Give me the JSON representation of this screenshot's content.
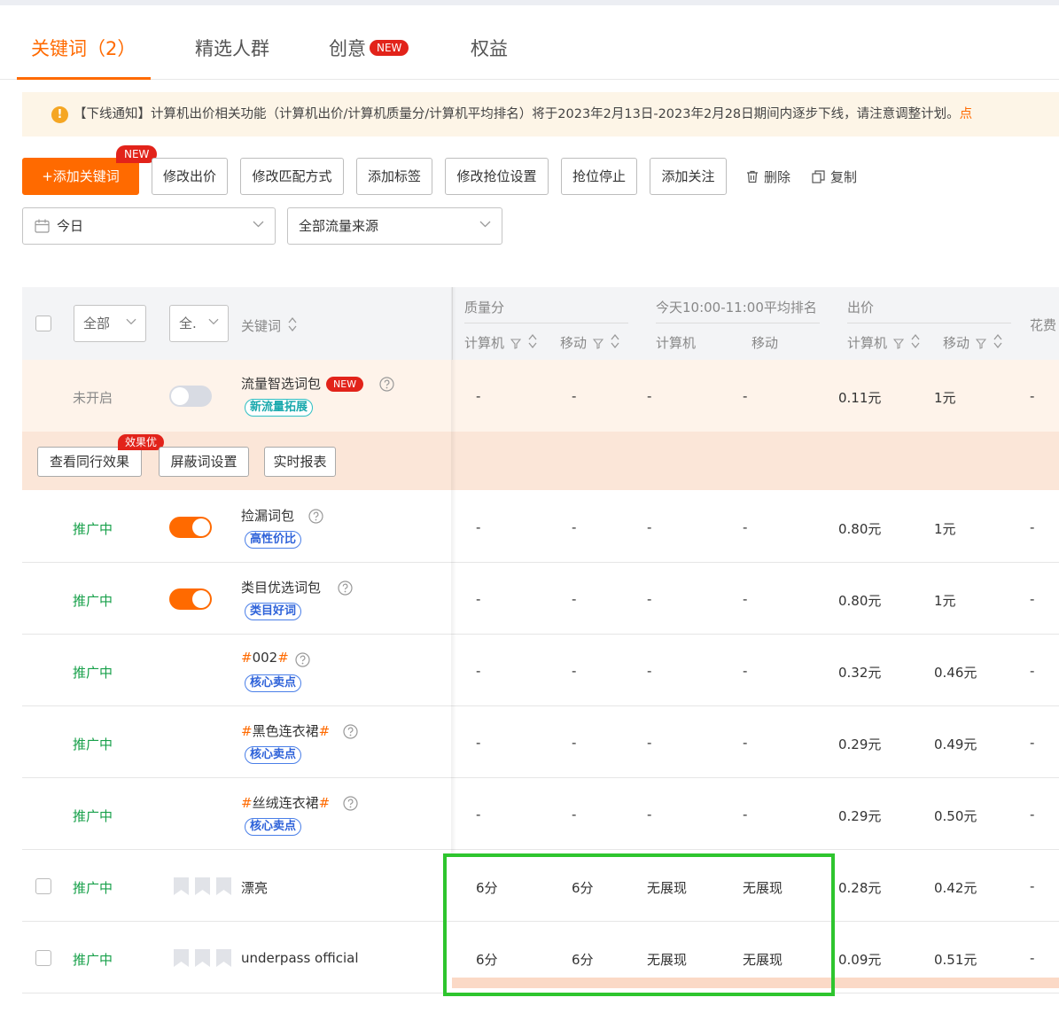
{
  "tabs": [
    {
      "label": "关键词（2）",
      "active": true
    },
    {
      "label": "精选人群"
    },
    {
      "label": "创意",
      "badge": "NEW"
    },
    {
      "label": "权益"
    }
  ],
  "notice": {
    "text": "【下线通知】计算机出价相关功能（计算机出价/计算机质量分/计算机平均排名）将于2023年2月13日-2023年2月28日期间内逐步下线，请注意调整计划。",
    "link": "点"
  },
  "toolbar": {
    "add_keyword": "+添加关键词",
    "add_keyword_badge": "NEW",
    "modify_bid": "修改出价",
    "modify_match": "修改匹配方式",
    "add_tag": "添加标签",
    "modify_rank": "修改抢位设置",
    "stop_rank": "抢位停止",
    "add_follow": "添加关注",
    "delete": "删除",
    "copy": "复制"
  },
  "filters": {
    "date": "今日",
    "traffic_source": "全部流量来源"
  },
  "table_header": {
    "status_select": "全部",
    "type_select": "全.",
    "keyword": "关键词",
    "quality_group": "质量分",
    "quality_pc": "计算机",
    "quality_mobile": "移动",
    "rank_group": "今天10:00-11:00平均排名",
    "rank_pc": "计算机",
    "rank_mobile": "移动",
    "bid_group": "出价",
    "bid_pc": "计算机",
    "bid_mobile": "移动",
    "cost": "花费"
  },
  "package_row": {
    "status": "未开启",
    "name": "流量智选词包",
    "badge": "NEW",
    "tag": "新流量拓展",
    "q_pc": "-",
    "q_m": "-",
    "r_pc": "-",
    "r_m": "-",
    "bid_pc": "0.11元",
    "bid_m": "1元",
    "cost": "-"
  },
  "sub_actions": {
    "peer_effect": "查看同行效果",
    "peer_badge": "效果优",
    "block_words": "屏蔽词设置",
    "realtime": "实时报表"
  },
  "rows": [
    {
      "status": "推广中",
      "name": "捡漏词包",
      "tag": "高性价比",
      "q_pc": "-",
      "q_m": "-",
      "r_pc": "-",
      "r_m": "-",
      "bid_pc": "0.80元",
      "bid_m": "1元",
      "cost": "-"
    },
    {
      "status": "推广中",
      "name": "类目优选词包",
      "tag": "类目好词",
      "q_pc": "-",
      "q_m": "-",
      "r_pc": "-",
      "r_m": "-",
      "bid_pc": "0.80元",
      "bid_m": "1元",
      "cost": "-"
    },
    {
      "status": "推广中",
      "hash": "#",
      "name": "002",
      "tag": "核心卖点",
      "q_pc": "-",
      "q_m": "-",
      "r_pc": "-",
      "r_m": "-",
      "bid_pc": "0.32元",
      "bid_m": "0.46元",
      "cost": "-"
    },
    {
      "status": "推广中",
      "hash": "#",
      "name": "黑色连衣裙",
      "tag": "核心卖点",
      "q_pc": "-",
      "q_m": "-",
      "r_pc": "-",
      "r_m": "-",
      "bid_pc": "0.29元",
      "bid_m": "0.49元",
      "cost": "-"
    },
    {
      "status": "推广中",
      "hash": "#",
      "name": "丝绒连衣裙",
      "tag": "核心卖点",
      "q_pc": "-",
      "q_m": "-",
      "r_pc": "-",
      "r_m": "-",
      "bid_pc": "0.29元",
      "bid_m": "0.50元",
      "cost": "-"
    },
    {
      "status": "推广中",
      "name": "漂亮",
      "q_pc": "6分",
      "q_m": "6分",
      "r_pc": "无展现",
      "r_m": "无展现",
      "bid_pc": "0.28元",
      "bid_m": "0.42元",
      "cost": "-"
    },
    {
      "status": "推广中",
      "name": "underpass official",
      "q_pc": "6分",
      "q_m": "6分",
      "r_pc": "无展现",
      "r_m": "无展现",
      "bid_pc": "0.09元",
      "bid_m": "0.51元",
      "cost": "-"
    }
  ],
  "colors": {
    "accent": "#ff6a00",
    "status_on": "#17a04a",
    "highlight_box": "#2ec52e"
  }
}
